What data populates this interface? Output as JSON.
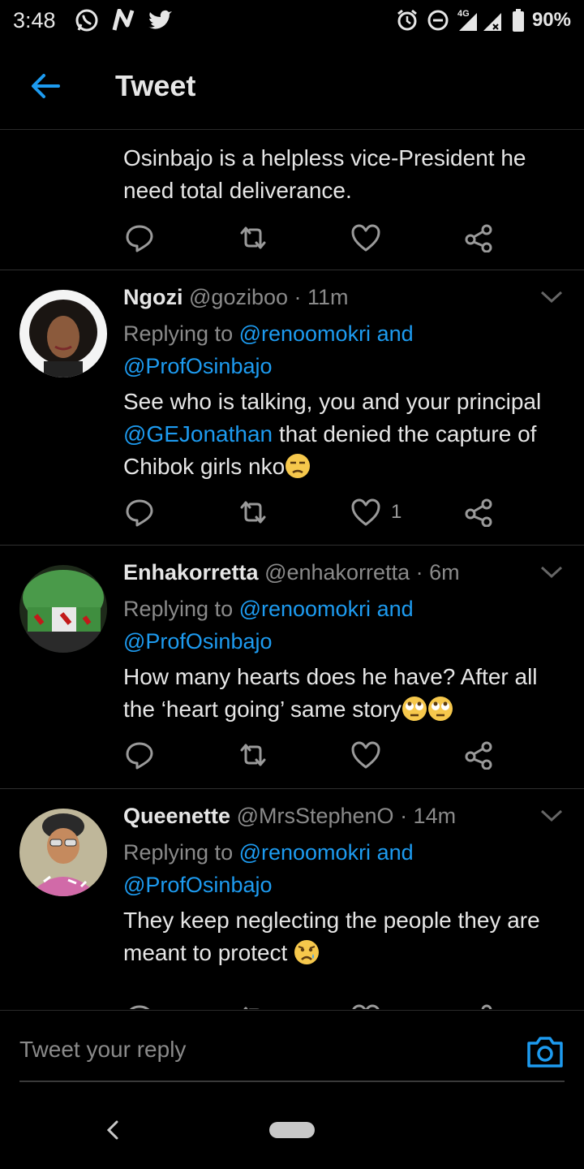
{
  "status": {
    "time": "3:48",
    "battery": "90%",
    "network": "4G",
    "left_icons": [
      "whatsapp-icon",
      "n-app-icon",
      "twitter-icon"
    ],
    "right_icons": [
      "alarm-icon",
      "dnd-icon",
      "signal-icon",
      "battery-icon"
    ]
  },
  "header": {
    "title": "Tweet"
  },
  "first_tweet": {
    "text": "Osinbajo is a helpless vice-President he need total deliverance."
  },
  "replies": [
    {
      "name": "Ngozi",
      "handle": "@goziboo",
      "time": "· 11m",
      "replying_prefix": "Replying to ",
      "replying_to_1": "@renoomokri",
      "replying_and": " and",
      "replying_to_2": "@ProfOsinbajo",
      "text_1": "See who is talking, you and your principal ",
      "mention": "@GEJonathan",
      "text_2": " that denied the capture of Chibok girls nko",
      "emoji": "unamused-face",
      "like_count": "1"
    },
    {
      "name": "Enhakorretta",
      "handle": "@enhakorretta",
      "time": "· 6m",
      "replying_prefix": "Replying to ",
      "replying_to_1": "@renoomokri",
      "replying_and": " and",
      "replying_to_2": "@ProfOsinbajo",
      "text_1": "How many hearts does he have? After all the ‘heart going’ same story",
      "emoji": "eye-roll-face"
    },
    {
      "name": "Queenette",
      "handle": "@MrsStephenO",
      "time": "· 14m",
      "replying_prefix": "Replying to ",
      "replying_to_1": "@renoomokri",
      "replying_and": " and",
      "replying_to_2": "@ProfOsinbajo",
      "text_1": "They keep neglecting the people they are meant to protect ",
      "emoji": "sad-relieved-face"
    }
  ],
  "reply_bar": {
    "placeholder": "Tweet your reply"
  },
  "colors": {
    "accent": "#1d9bf0",
    "background": "#000000",
    "secondary_text": "#8a8a8a"
  }
}
